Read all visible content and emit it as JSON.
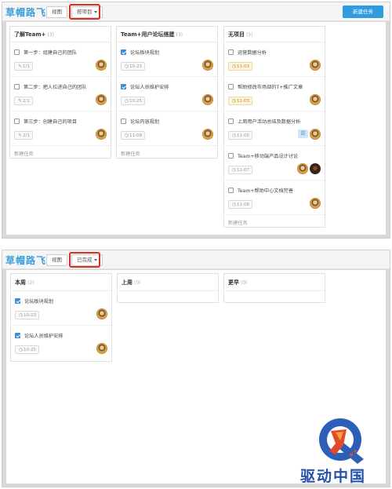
{
  "app": {
    "brand": "草帽路飞",
    "view_button": "视图",
    "new_task_button": "新建任务",
    "colors": {
      "brand": "#3aa0dc",
      "primary_button": "#2f9be0",
      "highlight": "#d93025",
      "checkbox": "#3a8fd9",
      "warn_date_bg": "#fff4de"
    }
  },
  "panel1": {
    "dropdown": "按项目",
    "columns": [
      {
        "title": "了解Team+",
        "count": "(3)",
        "cards": [
          {
            "title": "第一步：组建自己的团队",
            "meta": "1/1",
            "meta_icon": "tag-icon"
          },
          {
            "title": "第二步：把人拉进自己的团队",
            "meta": "2/1",
            "meta_icon": "tag-icon"
          },
          {
            "title": "第三步：创建自己的项目",
            "meta": "2/1",
            "meta_icon": "tag-icon"
          }
        ],
        "footer": "新建任务"
      },
      {
        "title": "Team+用户论坛搭建",
        "count": "(3)",
        "cards": [
          {
            "title": "论坛板块规划",
            "meta": "10-23",
            "meta_icon": "clock-icon",
            "checked": true
          },
          {
            "title": "论坛人员维护安排",
            "meta": "10-25",
            "meta_icon": "clock-icon",
            "checked": true
          },
          {
            "title": "论坛内容规划",
            "meta": "11-08",
            "meta_icon": "clock-icon",
            "checked": false
          }
        ],
        "footer": "新建任务"
      },
      {
        "title": "无项目",
        "count": "(5)",
        "cards": [
          {
            "title": "运营数据分析",
            "meta": "11-03",
            "meta_icon": "clock-icon"
          },
          {
            "title": "帮助修改市场部的T+推广文章",
            "meta": "11-03",
            "meta_icon": "clock-icon"
          },
          {
            "title": "上周用户活动总结及数据分析",
            "meta": "11-05",
            "meta_icon": "clock-icon"
          },
          {
            "title": "Team+移动端产品设计讨论",
            "meta": "11-07",
            "meta_icon": "clock-icon"
          },
          {
            "title": "Team+帮助中心文档完善",
            "meta": "11-08",
            "meta_icon": "clock-icon"
          }
        ],
        "footer": "新建任务"
      }
    ]
  },
  "panel2": {
    "dropdown": "已完成",
    "columns": [
      {
        "title": "本周",
        "count": "(2)",
        "cards": [
          {
            "title": "论坛板块规划",
            "meta": "10-23",
            "meta_icon": "clock-icon"
          },
          {
            "title": "论坛人员维护安排",
            "meta": "10-25",
            "meta_icon": "clock-icon"
          }
        ]
      },
      {
        "title": "上周",
        "count": "(0)"
      },
      {
        "title": "更早",
        "count": "(0)"
      }
    ]
  },
  "watermark": {
    "text": "驱动中国"
  }
}
